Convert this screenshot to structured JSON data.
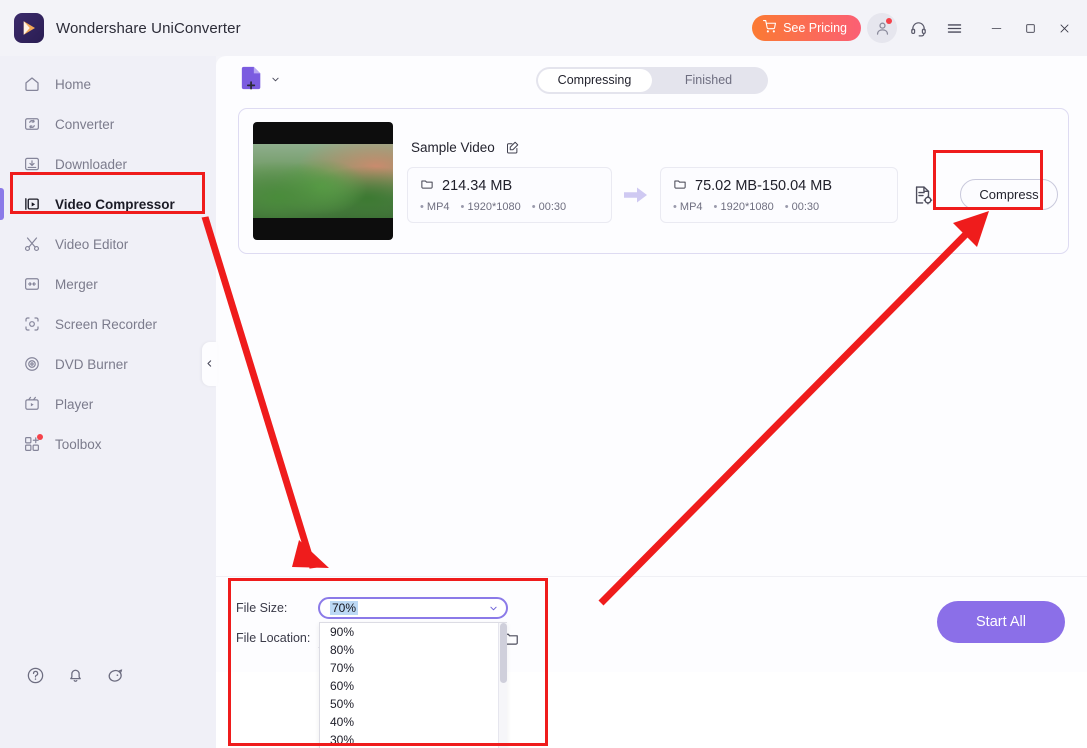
{
  "titlebar": {
    "app_name": "Wondershare UniConverter",
    "pricing_label": "See Pricing",
    "icons": [
      "cart-icon",
      "account-icon",
      "headset-support-icon",
      "menu-hamburger-icon",
      "minimize-icon",
      "maximize-icon",
      "close-icon"
    ]
  },
  "sidebar": {
    "items": [
      {
        "label": "Home",
        "icon": "home-icon",
        "active": false
      },
      {
        "label": "Converter",
        "icon": "converter-icon",
        "active": false
      },
      {
        "label": "Downloader",
        "icon": "downloader-icon",
        "active": false
      },
      {
        "label": "Video Compressor",
        "icon": "video-compressor-icon",
        "active": true
      },
      {
        "label": "Video Editor",
        "icon": "scissors-icon",
        "active": false
      },
      {
        "label": "Merger",
        "icon": "merger-icon",
        "active": false
      },
      {
        "label": "Screen Recorder",
        "icon": "screen-recorder-icon",
        "active": false
      },
      {
        "label": "DVD Burner",
        "icon": "dvd-burner-icon",
        "active": false
      },
      {
        "label": "Player",
        "icon": "player-icon",
        "active": false
      },
      {
        "label": "Toolbox",
        "icon": "toolbox-icon",
        "active": false,
        "badge": true
      }
    ],
    "bottom_icons": [
      "help-circle-icon",
      "notification-bell-icon",
      "feedback-icon"
    ],
    "collapse_icon": "chevron-left-icon"
  },
  "main": {
    "add_file": {
      "icon": "add-file-icon",
      "caret": "chevron-down-icon"
    },
    "tabs": [
      {
        "label": "Compressing",
        "active": true
      },
      {
        "label": "Finished",
        "active": false
      }
    ]
  },
  "file_card": {
    "title": "Sample Video",
    "edit_icon": "edit-pencil-icon",
    "thumbnail": "video-thumbnail",
    "input": {
      "folder_icon": "folder-icon",
      "size": "214.34 MB",
      "format": "MP4",
      "resolution": "1920*1080",
      "duration": "00:30"
    },
    "arrow_icon": "arrow-right-icon",
    "output": {
      "folder_icon": "folder-icon",
      "size": "75.02 MB-150.04 MB",
      "format": "MP4",
      "resolution": "1920*1080",
      "duration": "00:30"
    },
    "settings_icon": "file-settings-icon",
    "compress_label": "Compress"
  },
  "bottom": {
    "file_size_label": "File Size:",
    "file_location_label": "File Location:",
    "file_size_value": "70%",
    "file_size_options": [
      "90%",
      "80%",
      "70%",
      "60%",
      "50%",
      "40%",
      "30%"
    ],
    "select_caret_icon": "chevron-down-icon",
    "browse_icon": "folder-icon",
    "start_all_label": "Start All"
  },
  "colors": {
    "accent_purple": "#8b6fe8",
    "annotation_red": "#ef1c1c",
    "pricing_gradient_start": "#fb7a33",
    "pricing_gradient_end": "#fb5f74",
    "badge_red": "#f5424a",
    "select_highlight": "#bcd9f5"
  }
}
